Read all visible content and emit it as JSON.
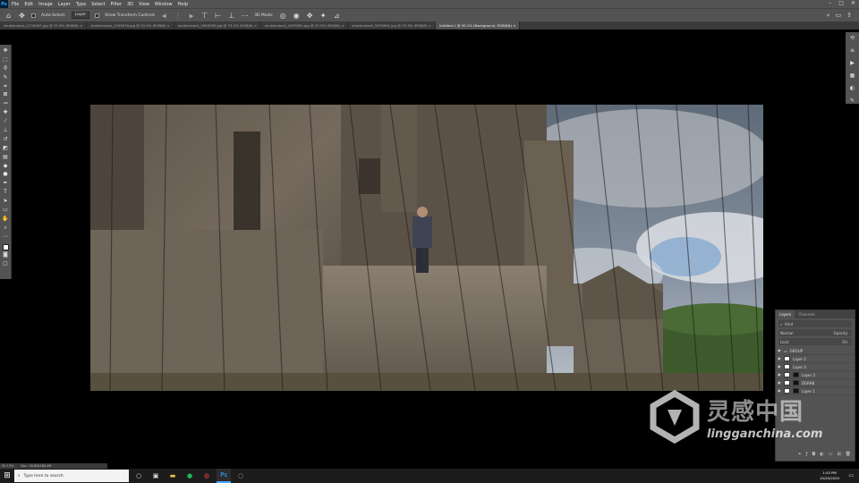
{
  "menubar": {
    "logo": "Ps",
    "items": [
      "File",
      "Edit",
      "Image",
      "Layer",
      "Type",
      "Select",
      "Filter",
      "3D",
      "View",
      "Window",
      "Help"
    ]
  },
  "options": {
    "auto_select_label": "Auto-Select:",
    "auto_select_value": "Layer",
    "show_transform_label": "Show Transform Controls",
    "mode_3d_label": "3D Mode:"
  },
  "tabs": [
    {
      "label": "shutterstock_1234567.jpg @ 33.3% (RGB/8) ×",
      "active": false
    },
    {
      "label": "shutterstock_2345678.jpg @ 33.3% (RGB/8) ×",
      "active": false
    },
    {
      "label": "shutterstock_3456789.jpg @ 33.3% (RGB/8) ×",
      "active": false
    },
    {
      "label": "shutterstock_4567890.jpg @ 33.3% (RGB/8) ×",
      "active": false
    },
    {
      "label": "shutterstock_5678901.jpg @ 33.3% (RGB/8) ×",
      "active": false
    },
    {
      "label": "Untitled-1 @ 50.1% (Background, RGB/8#) ×",
      "active": true
    }
  ],
  "toolbar": {
    "tools": [
      {
        "name": "move-tool-icon",
        "glyph": "✥"
      },
      {
        "name": "marquee-tool-icon",
        "glyph": "⬚"
      },
      {
        "name": "lasso-tool-icon",
        "glyph": "ϑ"
      },
      {
        "name": "quick-select-tool-icon",
        "glyph": "✎"
      },
      {
        "name": "crop-tool-icon",
        "glyph": "⌗"
      },
      {
        "name": "frame-tool-icon",
        "glyph": "⊠"
      },
      {
        "name": "eyedropper-tool-icon",
        "glyph": "⊸"
      },
      {
        "name": "healing-brush-tool-icon",
        "glyph": "✚"
      },
      {
        "name": "brush-tool-icon",
        "glyph": "⁄"
      },
      {
        "name": "clone-stamp-tool-icon",
        "glyph": "⊥"
      },
      {
        "name": "history-brush-tool-icon",
        "glyph": "↺"
      },
      {
        "name": "eraser-tool-icon",
        "glyph": "◩"
      },
      {
        "name": "gradient-tool-icon",
        "glyph": "▤"
      },
      {
        "name": "blur-tool-icon",
        "glyph": "◆"
      },
      {
        "name": "dodge-tool-icon",
        "glyph": "●"
      },
      {
        "name": "pen-tool-icon",
        "glyph": "✒"
      },
      {
        "name": "type-tool-icon",
        "glyph": "T"
      },
      {
        "name": "path-select-tool-icon",
        "glyph": "➤"
      },
      {
        "name": "shape-tool-icon",
        "glyph": "▭"
      },
      {
        "name": "hand-tool-icon",
        "glyph": "✋"
      },
      {
        "name": "zoom-tool-icon",
        "glyph": "⌕"
      },
      {
        "name": "more-tools-icon",
        "glyph": "⋯"
      }
    ]
  },
  "layers_panel": {
    "tab_layers": "Layers",
    "tab_channels": "Channels",
    "filter_label": "Kind",
    "blend_mode": "Normal",
    "opacity_label": "Opacity:",
    "fill_label": "Fill:",
    "lock_label": "Lock:",
    "layers": [
      {
        "name": "GROUP",
        "mask": false
      },
      {
        "name": "Layer 2",
        "mask": false
      },
      {
        "name": "Layer 4",
        "mask": false
      },
      {
        "name": "Layer 3",
        "mask": true
      },
      {
        "name": "DGRAB",
        "mask": true
      },
      {
        "name": "Layer 1",
        "mask": true
      }
    ]
  },
  "status": {
    "zoom": "50.13%",
    "doc": "Doc: 28.8M/286.4M"
  },
  "taskbar": {
    "search_placeholder": "Type here to search",
    "time": "1:43 PM",
    "date": "10/25/2020"
  },
  "watermark": {
    "cn": "灵感中国",
    "en": "lingganchina.com"
  }
}
